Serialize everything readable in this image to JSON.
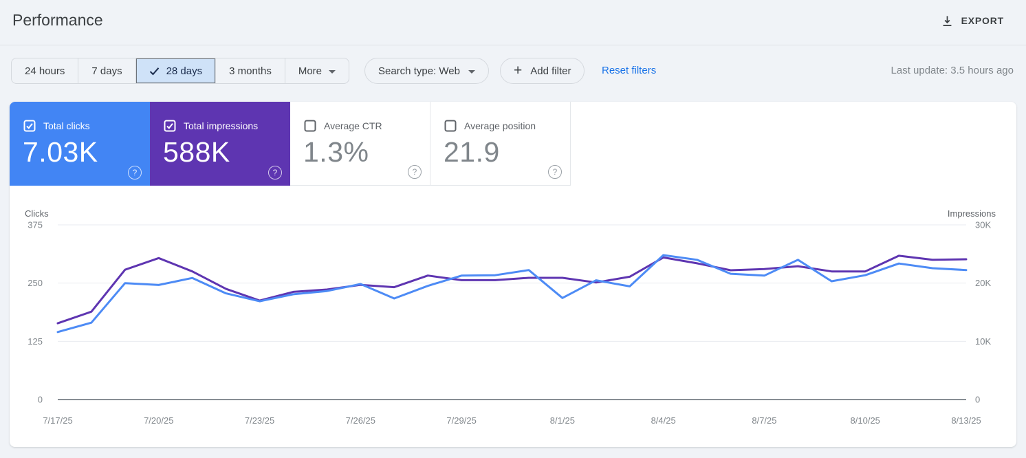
{
  "header": {
    "title": "Performance",
    "export_label": "EXPORT"
  },
  "toolbar": {
    "date_ranges": [
      {
        "label": "24 hours",
        "selected": false
      },
      {
        "label": "7 days",
        "selected": false
      },
      {
        "label": "28 days",
        "selected": true
      },
      {
        "label": "3 months",
        "selected": false
      },
      {
        "label": "More",
        "selected": false
      }
    ],
    "search_type_label": "Search type: Web",
    "add_filter_label": "Add filter",
    "reset_filters_label": "Reset filters",
    "last_update": "Last update: 3.5 hours ago"
  },
  "metrics": [
    {
      "label": "Total clicks",
      "value": "7.03K",
      "checked": true,
      "color": "#4285f4"
    },
    {
      "label": "Total impressions",
      "value": "588K",
      "checked": true,
      "color": "#5e35b1"
    },
    {
      "label": "Average CTR",
      "value": "1.3%",
      "checked": false,
      "color": "#ffffff"
    },
    {
      "label": "Average position",
      "value": "21.9",
      "checked": false,
      "color": "#ffffff"
    }
  ],
  "chart_data": {
    "type": "line",
    "title": "Clicks and impressions over time",
    "x": [
      "7/17/25",
      "7/18/25",
      "7/19/25",
      "7/20/25",
      "7/21/25",
      "7/22/25",
      "7/23/25",
      "7/24/25",
      "7/25/25",
      "7/26/25",
      "7/27/25",
      "7/28/25",
      "7/29/25",
      "7/30/25",
      "7/31/25",
      "8/1/25",
      "8/2/25",
      "8/3/25",
      "8/4/25",
      "8/5/25",
      "8/6/25",
      "8/7/25",
      "8/8/25",
      "8/9/25",
      "8/10/25",
      "8/11/25",
      "8/12/25",
      "8/13/25"
    ],
    "x_tick_labels": [
      "7/17/25",
      "7/20/25",
      "7/23/25",
      "7/26/25",
      "7/29/25",
      "8/1/25",
      "8/4/25",
      "8/7/25",
      "8/10/25",
      "8/13/25"
    ],
    "series": [
      {
        "name": "Clicks",
        "axis": "left",
        "color": "#4d8bf5",
        "values": [
          145,
          165,
          250,
          246,
          261,
          228,
          211,
          226,
          233,
          248,
          217,
          244,
          266,
          267,
          278,
          218,
          256,
          243,
          310,
          300,
          270,
          266,
          300,
          254,
          267,
          292,
          282,
          278
        ]
      },
      {
        "name": "Impressions",
        "axis": "right",
        "color": "#5e35b1",
        "values": [
          13100,
          15100,
          22300,
          24300,
          22000,
          19000,
          17000,
          18500,
          18900,
          19700,
          19300,
          21300,
          20500,
          20500,
          20900,
          20900,
          20100,
          21100,
          24400,
          23400,
          22200,
          22400,
          22900,
          22000,
          22000,
          24700,
          24000,
          24100
        ]
      }
    ],
    "left_axis": {
      "label": "Clicks",
      "ticks": [
        "375",
        "250",
        "125",
        "0"
      ],
      "min": 0,
      "max": 375
    },
    "right_axis": {
      "label": "Impressions",
      "ticks": [
        "30K",
        "20K",
        "10K",
        "0"
      ],
      "min": 0,
      "max": 30000
    },
    "grid": true,
    "legend_position": "none"
  }
}
